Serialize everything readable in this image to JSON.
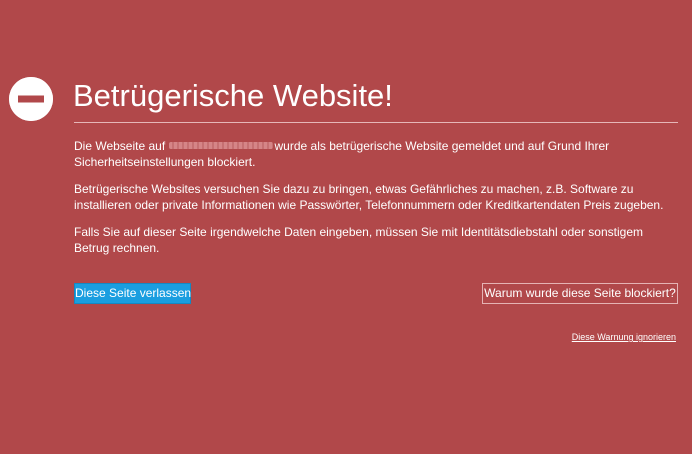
{
  "colors": {
    "background": "#b1484a",
    "primary_button": "#1a9ee0",
    "text": "#ffffff"
  },
  "icon": "blocked-minus-icon",
  "header": {
    "title": "Betrügerische Website!"
  },
  "message": {
    "p1_before": "Die Webseite auf",
    "p1_after": "wurde als betrügerische Website gemeldet und auf Grund Ihrer Sicherheitseinstellungen blockiert.",
    "p2": "Betrügerische Websites versuchen Sie dazu zu bringen, etwas Gefährliches zu machen, z.B. Software zu installieren oder private Informationen wie Passwörter, Telefonnummern oder Kreditkartendaten Preis zugeben.",
    "p3": "Falls Sie auf dieser Seite irgendwelche Daten eingeben, müssen Sie mit Identitätsdiebstahl oder sonstigem Betrug rechnen."
  },
  "actions": {
    "leave_label": "Diese Seite verlassen",
    "why_label": "Warum wurde diese Seite blockiert?",
    "ignore_label": "Diese Warnung ignorieren"
  }
}
